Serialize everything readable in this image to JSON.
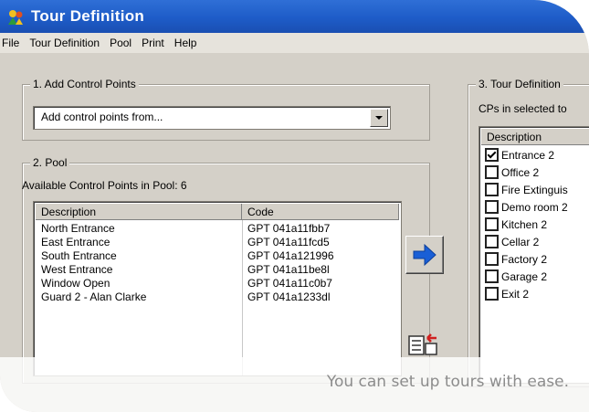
{
  "window": {
    "title": "Tour Definition"
  },
  "menu": [
    "File",
    "Tour Definition",
    "Pool",
    "Print",
    "Help"
  ],
  "add_control_points": {
    "label": "1. Add Control Points",
    "combo_value": "Add control points from..."
  },
  "pool": {
    "label": "2. Pool",
    "available": "Available Control Points in Pool: 6",
    "headers": [
      "Description",
      "Code"
    ],
    "rows": [
      {
        "description": "North Entrance",
        "code": "GPT 041a11fbb7"
      },
      {
        "description": "East Entrance",
        "code": "GPT 041a11fcd5"
      },
      {
        "description": "South Entrance",
        "code": "GPT 041a121996"
      },
      {
        "description": "West Entrance",
        "code": "GPT 041a11be8l"
      },
      {
        "description": "Window Open",
        "code": "GPT 041a11c0b7"
      },
      {
        "description": "Guard 2 - Alan Clarke",
        "code": "GPT 041a1233dl"
      }
    ]
  },
  "tour_definition": {
    "label": "3. Tour Definition",
    "subtitle": "CPs in selected to",
    "header": "Description",
    "items": [
      {
        "label": "Entrance 2",
        "checked": true
      },
      {
        "label": "Office 2",
        "checked": false
      },
      {
        "label": "Fire Extinguis",
        "checked": false
      },
      {
        "label": "Demo room 2",
        "checked": false
      },
      {
        "label": "Kitchen 2",
        "checked": false
      },
      {
        "label": "Cellar 2",
        "checked": false
      },
      {
        "label": "Factory 2",
        "checked": false
      },
      {
        "label": "Garage 2",
        "checked": false
      },
      {
        "label": "Exit 2",
        "checked": false
      }
    ]
  },
  "icons": {
    "app": "tour-app-icon",
    "move_right": "arrow-right-icon",
    "pool_transfer": "list-transfer-icon"
  },
  "colors": {
    "arrow": "#1a5fd6",
    "titlebar": "#1e5cc8"
  },
  "caption": "You can set up tours with ease."
}
